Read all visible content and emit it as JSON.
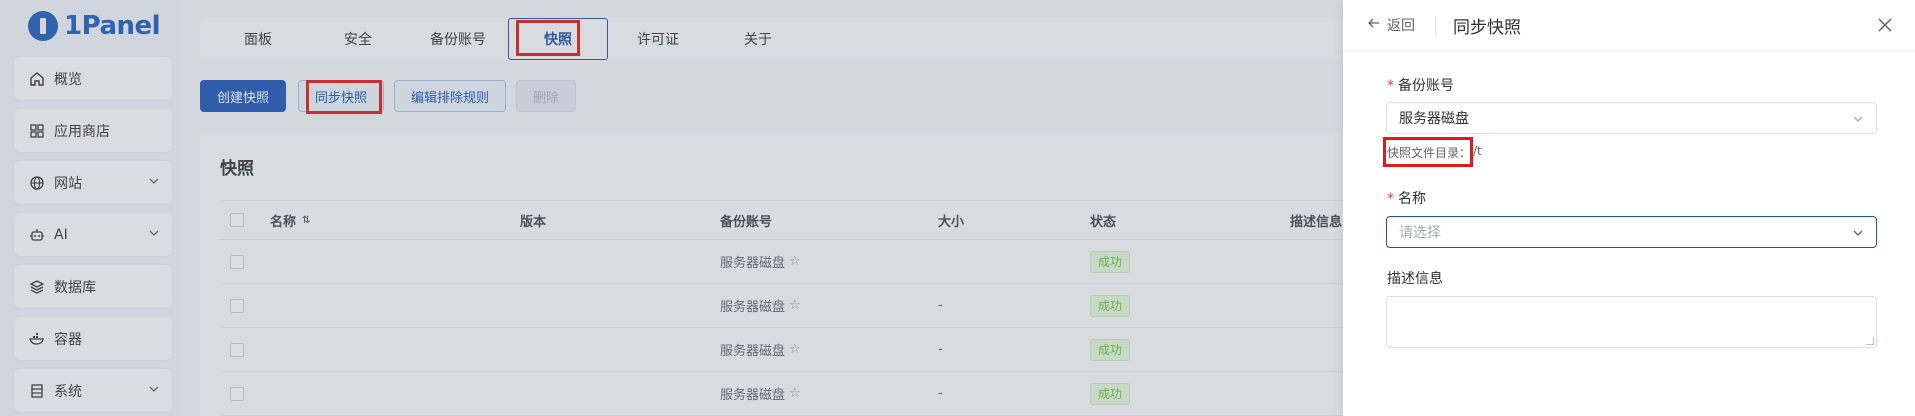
{
  "app": {
    "logo_text": "1Panel",
    "accent": "#1c52b4",
    "highlight": "#e01919"
  },
  "sidebar": {
    "items": [
      {
        "label": "概览",
        "icon": "home-icon",
        "chevron": false
      },
      {
        "label": "应用商店",
        "icon": "grid-icon",
        "chevron": false
      },
      {
        "label": "网站",
        "icon": "globe-icon",
        "chevron": true
      },
      {
        "label": "AI",
        "icon": "robot-icon",
        "chevron": true
      },
      {
        "label": "数据库",
        "icon": "layers-icon",
        "chevron": false
      },
      {
        "label": "容器",
        "icon": "docker-icon",
        "chevron": false
      },
      {
        "label": "系统",
        "icon": "server-icon",
        "chevron": true
      }
    ]
  },
  "tabs": [
    {
      "label": "面板",
      "active": false
    },
    {
      "label": "安全",
      "active": false
    },
    {
      "label": "备份账号",
      "active": false
    },
    {
      "label": "快照",
      "active": true
    },
    {
      "label": "许可证",
      "active": false
    },
    {
      "label": "关于",
      "active": false
    }
  ],
  "actions": {
    "create": "创建快照",
    "sync": "同步快照",
    "edit_rules": "编辑排除规则",
    "delete": "删除"
  },
  "card": {
    "title": "快照",
    "columns": [
      "名称",
      "版本",
      "备份账号",
      "大小",
      "状态",
      "描述信息"
    ],
    "rows": [
      {
        "name": "",
        "version": "",
        "account": "服务器磁盘",
        "size": "",
        "status": "成功",
        "desc": ""
      },
      {
        "name": "",
        "version": "",
        "account": "服务器磁盘",
        "size": "-",
        "status": "成功",
        "desc": ""
      },
      {
        "name": "",
        "version": "",
        "account": "服务器磁盘",
        "size": "-",
        "status": "成功",
        "desc": ""
      },
      {
        "name": "",
        "version": "",
        "account": "服务器磁盘",
        "size": "-",
        "status": "成功",
        "desc": ""
      }
    ]
  },
  "drawer": {
    "back_label": "返回",
    "title": "同步快照",
    "backup_account_label": "备份账号",
    "backup_account_value": "服务器磁盘",
    "dir_hint_label": "快照文件目录：",
    "dir_hint_value": "/t",
    "name_label": "名称",
    "name_placeholder": "请选择",
    "desc_label": "描述信息"
  }
}
